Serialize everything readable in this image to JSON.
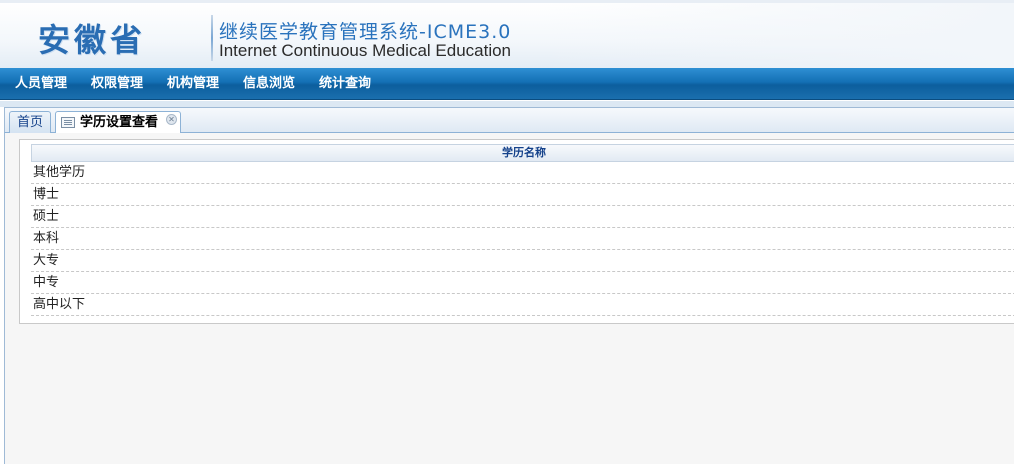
{
  "header": {
    "logo_text": "安徽省",
    "title_cn": "继续医学教育管理系统-ICME3.0",
    "title_en": "Internet Continuous Medical Education"
  },
  "nav": {
    "items": [
      "人员管理",
      "权限管理",
      "机构管理",
      "信息浏览",
      "统计查询"
    ]
  },
  "tabs": {
    "home_label": "首页",
    "active_label": "学历设置查看",
    "close_glyph": "✕"
  },
  "grid": {
    "column_header": "学历名称",
    "rows": [
      "其他学历",
      "博士",
      "硕士",
      "本科",
      "大专",
      "中专",
      "高中以下"
    ]
  },
  "colors": {
    "nav_bg": "#1470b5",
    "title_blue": "#2a73bd",
    "header_text": "#15428b"
  }
}
